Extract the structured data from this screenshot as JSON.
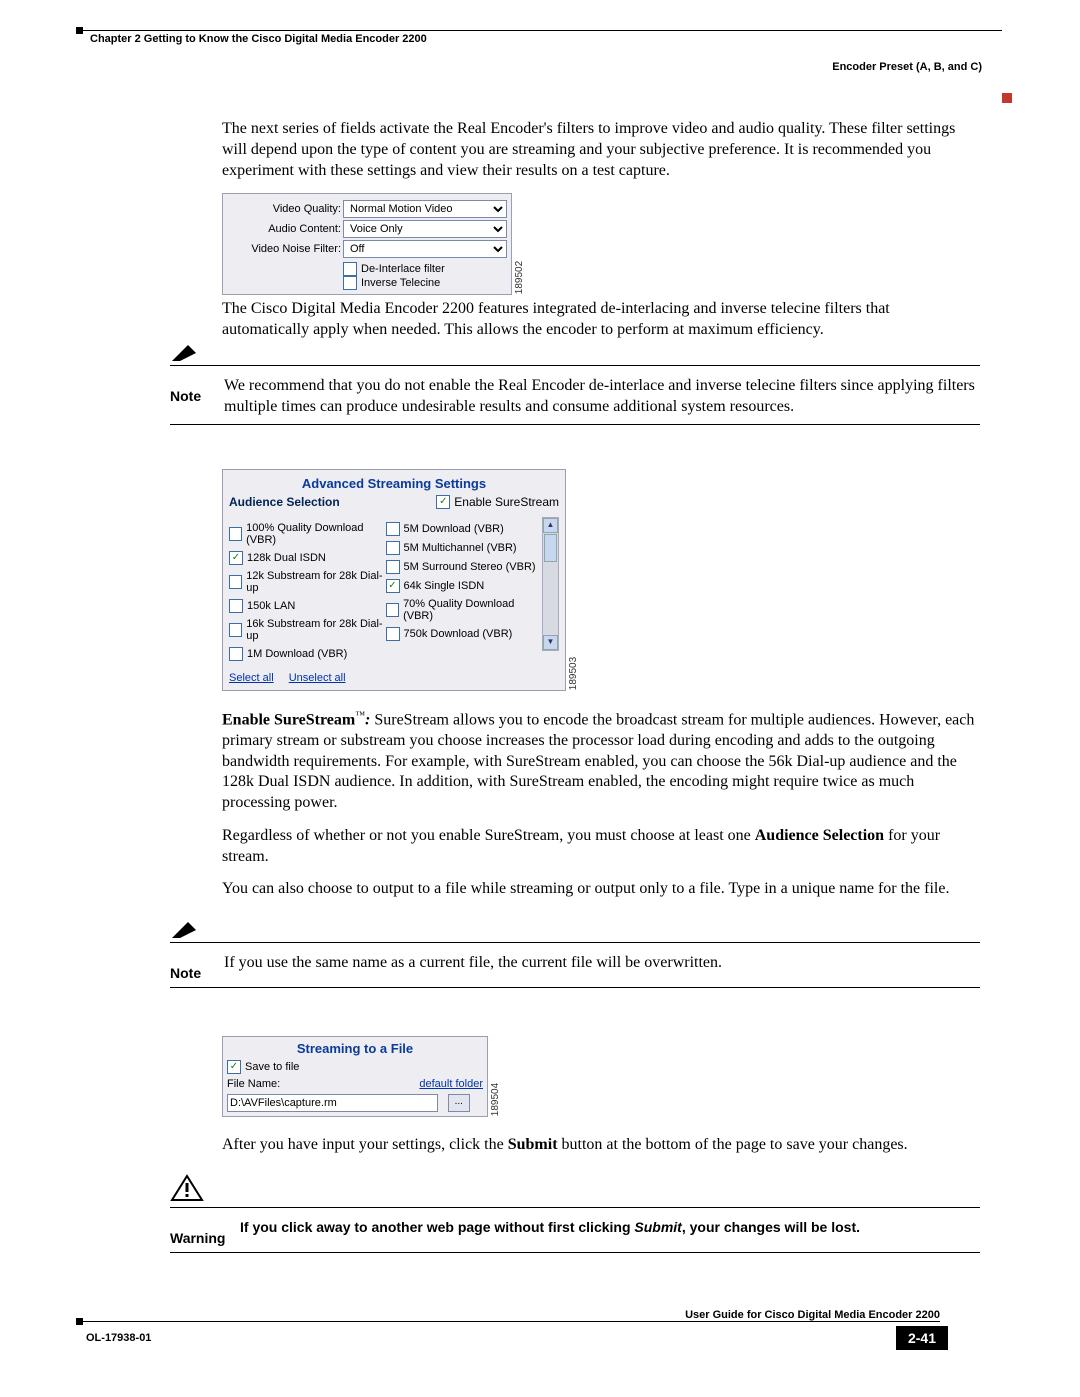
{
  "header": {
    "chapter_line": "Chapter 2    Getting to Know the Cisco Digital Media Encoder 2200",
    "section_right": "Encoder Preset (A, B, and C)"
  },
  "para1": "The next series of fields activate the Real Encoder's filters to improve video and audio quality. These filter settings will depend upon the type of content you are streaming and your subjective preference. It is recommended you experiment with these settings and view their results on a test capture.",
  "fig1": {
    "video_quality_label": "Video Quality:",
    "video_quality_value": "Normal Motion Video",
    "audio_content_label": "Audio Content:",
    "audio_content_value": "Voice Only",
    "noise_filter_label": "Video Noise Filter:",
    "noise_filter_value": "Off",
    "cb_deinterlace": "De-Interlace filter",
    "cb_invtelecine": "Inverse Telecine",
    "id": "189502"
  },
  "para2": "The Cisco Digital Media Encoder 2200 features integrated de-interlacing and inverse telecine filters that automatically apply when needed. This allows the encoder to perform at maximum efficiency.",
  "note1": {
    "label": "Note",
    "text": "We recommend that you do not enable the Real Encoder de-interlace and inverse telecine filters since applying filters multiple times can produce undesirable results and consume additional system resources."
  },
  "fig2": {
    "title": "Advanced Streaming Settings",
    "aud_label": "Audience Selection",
    "enable_label": "Enable SureStream",
    "left": [
      {
        "checked": false,
        "label": "100% Quality Download (VBR)"
      },
      {
        "checked": true,
        "label": "128k Dual ISDN"
      },
      {
        "checked": false,
        "label": "12k Substream for 28k Dial-up"
      },
      {
        "checked": false,
        "label": "150k LAN"
      },
      {
        "checked": false,
        "label": "16k Substream for 28k Dial-up"
      },
      {
        "checked": false,
        "label": "1M Download (VBR)"
      }
    ],
    "right": [
      {
        "checked": false,
        "label": "5M Download (VBR)"
      },
      {
        "checked": false,
        "label": "5M Multichannel (VBR)"
      },
      {
        "checked": false,
        "label": "5M Surround Stereo (VBR)"
      },
      {
        "checked": true,
        "label": "64k Single ISDN"
      },
      {
        "checked": false,
        "label": "70% Quality Download (VBR)"
      },
      {
        "checked": false,
        "label": "750k Download (VBR)"
      }
    ],
    "select_all": "Select all",
    "unselect_all": "Unselect all",
    "id": "189503"
  },
  "surestream_lead": "Enable SureStream",
  "surestream_tm": "™",
  "surestream_colon": ":",
  "para3": " SureStream allows you to encode the broadcast stream for multiple audiences. However, each primary stream or substream you choose increases the processor load during encoding and adds to the outgoing bandwidth requirements. For example, with SureStream enabled, you can choose the 56k Dial-up audience and the 128k Dual ISDN audience. In addition, with SureStream enabled, the encoding might require twice as much processing power.",
  "para4a": "Regardless of whether or not you enable SureStream, you must choose at least one ",
  "para4b": "Audience Selection",
  "para4c": " for your stream.",
  "para5": "You can also choose to output to a file while streaming or output only to a file. Type in a unique name for the file.",
  "note2": {
    "label": "Note",
    "text": "If you use the same name as a current file, the current file will be overwritten."
  },
  "fig3": {
    "title": "Streaming to a File",
    "save_to_file": "Save to file",
    "file_name_label": "File Name:",
    "default_folder": "default folder",
    "path": "D:\\AVFiles\\capture.rm",
    "id": "189504"
  },
  "para6a": "After you have input your settings, click the ",
  "para6b": "Submit",
  "para6c": " button at the bottom of the page to save your changes.",
  "warning": {
    "label": "Warning",
    "text_a": "If you click away to another web page without first clicking ",
    "text_b": "Submit",
    "text_c": ", your changes will be lost."
  },
  "footer": {
    "guide": "User Guide for Cisco Digital Media Encoder 2200",
    "docnum": "OL-17938-01",
    "page": "2-41"
  }
}
